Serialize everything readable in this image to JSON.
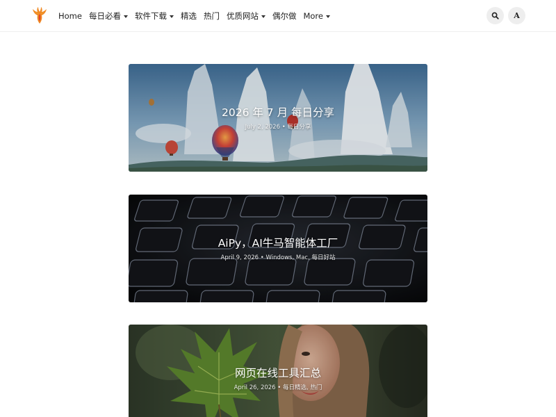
{
  "header": {
    "logo_icon": "phoenix-logo-icon",
    "nav": [
      {
        "label": "Home",
        "dropdown": false
      },
      {
        "label": "每日必看",
        "dropdown": true
      },
      {
        "label": "软件下载",
        "dropdown": true
      },
      {
        "label": "精选",
        "dropdown": false
      },
      {
        "label": "热门",
        "dropdown": false
      },
      {
        "label": "优质网站",
        "dropdown": true
      },
      {
        "label": "偶尔做",
        "dropdown": false
      },
      {
        "label": "More",
        "dropdown": true
      }
    ],
    "search_icon": "search-icon",
    "font_toggle_label": "A"
  },
  "posts": [
    {
      "title": "2026 年 7 月 每日分享",
      "date": "July 2, 2026",
      "categories": "每日分享",
      "separator": " • ",
      "image": "hot-air-balloons-landscape"
    },
    {
      "title": "AiPy，AI牛马智能体工厂",
      "date": "April 9, 2026",
      "categories": "Windows, Mac, 每日好站",
      "separator": " • ",
      "image": "dark-keyboard-closeup"
    },
    {
      "title": "网页在线工具汇总",
      "date": "April 26, 2026",
      "categories": "每日精选, 热门",
      "separator": " • ",
      "image": "woman-with-maple-leaf"
    }
  ],
  "colors": {
    "header_bg": "#ffffff",
    "button_bg": "#eeeeee",
    "logo_orange": "#f08a24",
    "logo_red": "#e0452b"
  }
}
